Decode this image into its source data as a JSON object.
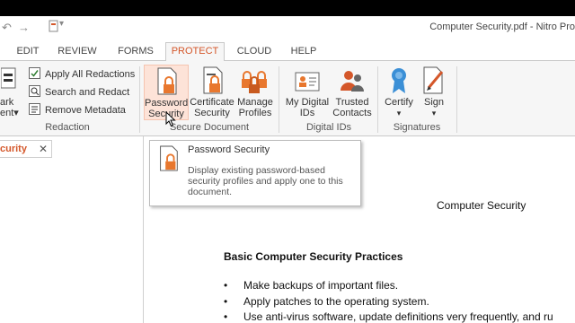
{
  "window": {
    "title": "Computer Security.pdf - Nitro Pro"
  },
  "tabs": [
    {
      "label": "EDIT"
    },
    {
      "label": "REVIEW"
    },
    {
      "label": "FORMS"
    },
    {
      "label": "PROTECT",
      "active": true
    },
    {
      "label": "CLOUD"
    },
    {
      "label": "HELP"
    }
  ],
  "ribbon": {
    "redaction": {
      "mark_label_1": "ark",
      "mark_label_2": "ent",
      "apply_all": "Apply All Redactions",
      "search_redact": "Search and Redact",
      "remove_metadata": "Remove Metadata",
      "group": "Redaction"
    },
    "secure": {
      "password_1": "Password",
      "password_2": "Security",
      "certificate_1": "Certificate",
      "certificate_2": "Security",
      "manage_1": "Manage",
      "manage_2": "Profiles",
      "group": "Secure Document"
    },
    "digital_ids": {
      "my_1": "My Digital",
      "my_2": "IDs",
      "trusted_1": "Trusted",
      "trusted_2": "Contacts",
      "group": "Digital IDs"
    },
    "signatures": {
      "certify": "Certify",
      "sign": "Sign",
      "group": "Signatures"
    }
  },
  "doc_tab": {
    "label": "curity",
    "close": "✕"
  },
  "tooltip": {
    "title": "Password Security",
    "description": "Display existing password-based security profiles and apply one to this document."
  },
  "document": {
    "title": "Computer Security",
    "heading": "Basic Computer Security Practices",
    "bullets": [
      "Make backups of important files.",
      "Apply patches to the operating system.",
      "Use anti-virus software, update definitions very frequently, and ru"
    ]
  },
  "colors": {
    "accent": "#d4572a",
    "lock_orange": "#e8772e",
    "ribbon_bg": "#f6f6f6"
  }
}
